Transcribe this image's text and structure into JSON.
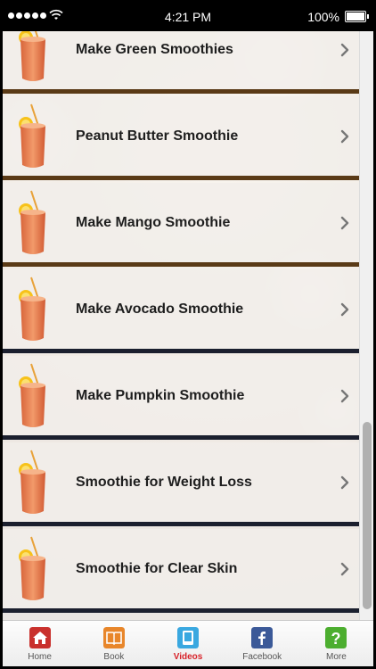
{
  "status_bar": {
    "time": "4:21 PM",
    "battery": "100%"
  },
  "list": {
    "items": [
      {
        "label": "Make Green Smoothies"
      },
      {
        "label": "Peanut Butter Smoothie"
      },
      {
        "label": "Make Mango Smoothie"
      },
      {
        "label": "Make Avocado Smoothie"
      },
      {
        "label": "Make Pumpkin Smoothie"
      },
      {
        "label": "Smoothie for Weight Loss"
      },
      {
        "label": "Smoothie for Clear Skin"
      }
    ]
  },
  "tab_bar": {
    "tabs": [
      {
        "label": "Home",
        "icon": "home-icon"
      },
      {
        "label": "Book",
        "icon": "book-icon"
      },
      {
        "label": "Videos",
        "icon": "videos-icon",
        "active": true
      },
      {
        "label": "Facebook",
        "icon": "facebook-icon"
      },
      {
        "label": "More",
        "icon": "more-icon"
      }
    ]
  },
  "colors": {
    "active_tab": "#d8232a",
    "row_divider_brown": "#5a3a16",
    "row_divider_navy": "#1b1f2e"
  }
}
